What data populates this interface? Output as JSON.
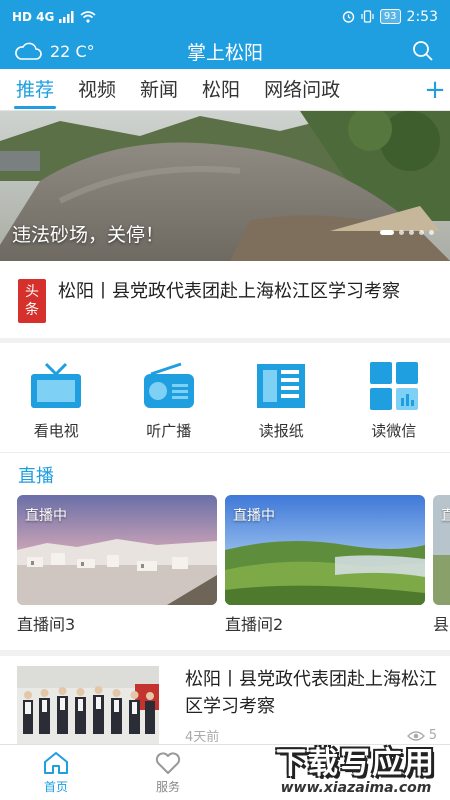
{
  "status_bar": {
    "network": "HD 4G",
    "battery": "93",
    "time": "2:53"
  },
  "header": {
    "temperature": "22 C°",
    "title": "掌上松阳"
  },
  "tabs": [
    "推荐",
    "视频",
    "新闻",
    "松阳",
    "网络问政"
  ],
  "tabs_add": "+",
  "banner": {
    "caption": "违法砂场，关停！"
  },
  "headline": {
    "badge_line1": "头",
    "badge_line2": "条",
    "text": "松阳丨县党政代表团赴上海松江区学习考察"
  },
  "quick_links": [
    {
      "label": "看电视",
      "icon": "tv-icon"
    },
    {
      "label": "听广播",
      "icon": "radio-icon"
    },
    {
      "label": "读报纸",
      "icon": "newspaper-icon"
    },
    {
      "label": "读微信",
      "icon": "wechat-grid-icon"
    }
  ],
  "live": {
    "section_title": "直播",
    "cards": [
      {
        "tag": "直播中",
        "title": "直播间3"
      },
      {
        "tag": "直播中",
        "title": "直播间2"
      },
      {
        "tag": "直",
        "title": "县"
      }
    ]
  },
  "news": {
    "title": "松阳丨县党政代表团赴上海松江区学习考察",
    "time": "4天前",
    "views": "5"
  },
  "bottom_nav": [
    {
      "label": "首页",
      "icon": "home-icon"
    },
    {
      "label": "服务",
      "icon": "heart-icon"
    }
  ],
  "watermark": {
    "main": "下载写应用",
    "sub": "www.xiazaima.com"
  },
  "colors": {
    "brand": "#1f9ee0",
    "badge": "#d5302c"
  }
}
